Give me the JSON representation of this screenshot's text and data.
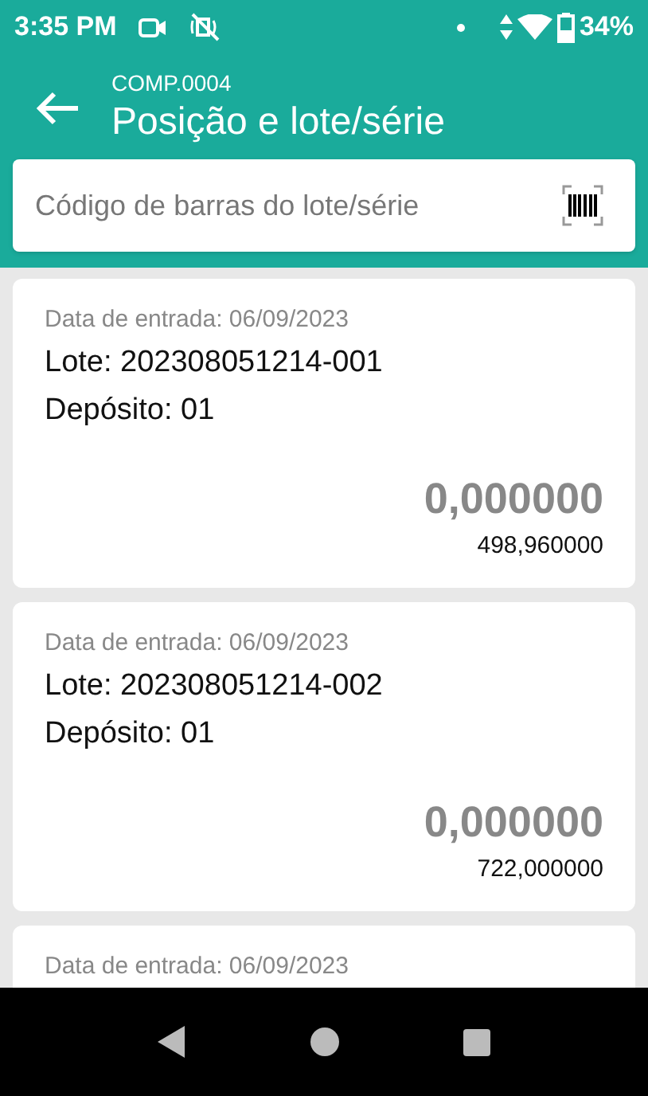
{
  "status_bar": {
    "time": "3:35 PM",
    "battery": "34%"
  },
  "header": {
    "subtitle": "COMP.0004",
    "title": "Posição e lote/série"
  },
  "search": {
    "placeholder": "Código de barras do lote/série"
  },
  "lots": [
    {
      "date": "Data de entrada: 06/09/2023",
      "lot": "Lote: 202308051214-001",
      "warehouse": "Depósito: 01",
      "quantity": "0,000000",
      "balance": "498,960000"
    },
    {
      "date": "Data de entrada: 06/09/2023",
      "lot": "Lote: 202308051214-002",
      "warehouse": "Depósito: 01",
      "quantity": "0,000000",
      "balance": "722,000000"
    },
    {
      "date": "Data de entrada: 06/09/2023"
    }
  ]
}
